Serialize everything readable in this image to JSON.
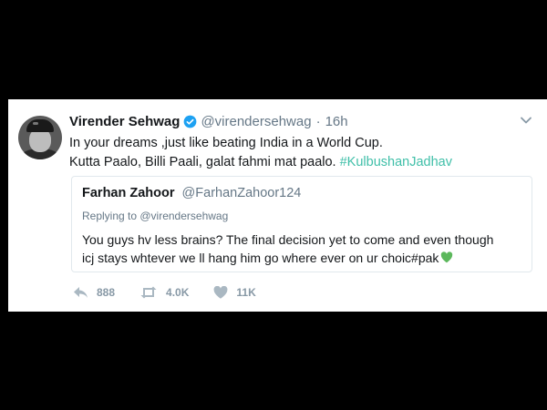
{
  "tweet": {
    "author_name": "Virender Sehwag",
    "handle": "@virendersehwag",
    "separator": "·",
    "time": "16h",
    "line1": "In your dreams ,just like beating India in a World Cup.",
    "line2_text": "Kutta Paalo, Billi Paali, galat fahmi mat paalo. ",
    "hashtag": "#KulbushanJadhav",
    "hashtag_color": "#3fbfa8"
  },
  "quoted": {
    "author_name": "Farhan Zahoor",
    "handle": "@FarhanZahoor124",
    "replying_to": "Replying to @virendersehwag",
    "line1": "You guys hv less brains?  The final decision yet to come and even though",
    "line2": "icj stays whtever we ll hang him go where ever on ur choic#pak"
  },
  "actions": {
    "reply_count": "888",
    "retweet_count": "4.0K",
    "like_count": "11K"
  },
  "icons": [
    "reply-icon",
    "retweet-icon",
    "like-icon",
    "verified-icon",
    "caret-down-icon",
    "green-heart-icon"
  ]
}
